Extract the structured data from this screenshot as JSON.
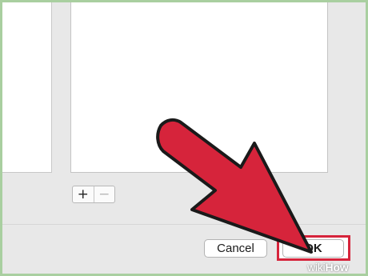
{
  "dialog": {
    "add_label": "+",
    "remove_label": "−",
    "cancel_label": "Cancel",
    "ok_label": "OK"
  },
  "annotation": {
    "arrow_color": "#d6243b",
    "highlight_color": "#d6243b"
  },
  "watermark": {
    "part1": "wiki",
    "part2": "How"
  },
  "colors": {
    "frame_border": "#a9cfa0",
    "dialog_bg": "#e8e8e8"
  }
}
